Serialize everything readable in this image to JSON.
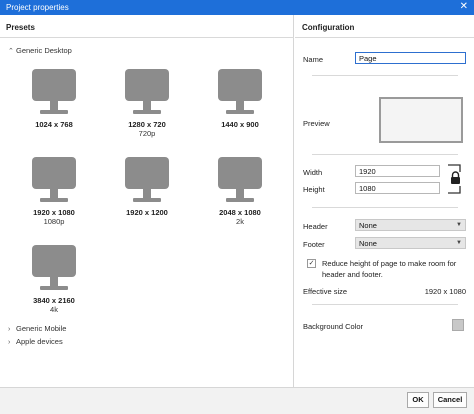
{
  "window": {
    "title": "Project properties",
    "close_glyph": "✕"
  },
  "presets": {
    "heading": "Presets",
    "groups": [
      {
        "label": "Generic Desktop",
        "expanded": true
      },
      {
        "label": "Generic Mobile",
        "expanded": false
      },
      {
        "label": "Apple devices",
        "expanded": false
      }
    ],
    "items": [
      {
        "label": "1024 x 768",
        "sub": ""
      },
      {
        "label": "1280 x 720",
        "sub": "720p"
      },
      {
        "label": "1440 x 900",
        "sub": ""
      },
      {
        "label": "1920 x 1080",
        "sub": "1080p"
      },
      {
        "label": "1920 x 1200",
        "sub": ""
      },
      {
        "label": "2048 x 1080",
        "sub": "2k"
      },
      {
        "label": "3840 x 2160",
        "sub": "4k"
      }
    ]
  },
  "config": {
    "heading": "Configuration",
    "name_label": "Name",
    "name_value": "Page",
    "preview_label": "Preview",
    "width_label": "Width",
    "width_value": "1920",
    "height_label": "Height",
    "height_value": "1080",
    "header_label": "Header",
    "header_value": "None",
    "footer_label": "Footer",
    "footer_value": "None",
    "reduce_checked": true,
    "reduce_text": "Reduce height of page to make room for header and footer.",
    "effective_label": "Effective size",
    "effective_value": "1920 x 1080",
    "bg_label": "Background Color",
    "bg_color": "#c8c8c8"
  },
  "buttons": {
    "ok": "OK",
    "cancel": "Cancel"
  },
  "colors": {
    "titlebar": "#1e6fd9",
    "monitor": "#8c8c8c"
  }
}
